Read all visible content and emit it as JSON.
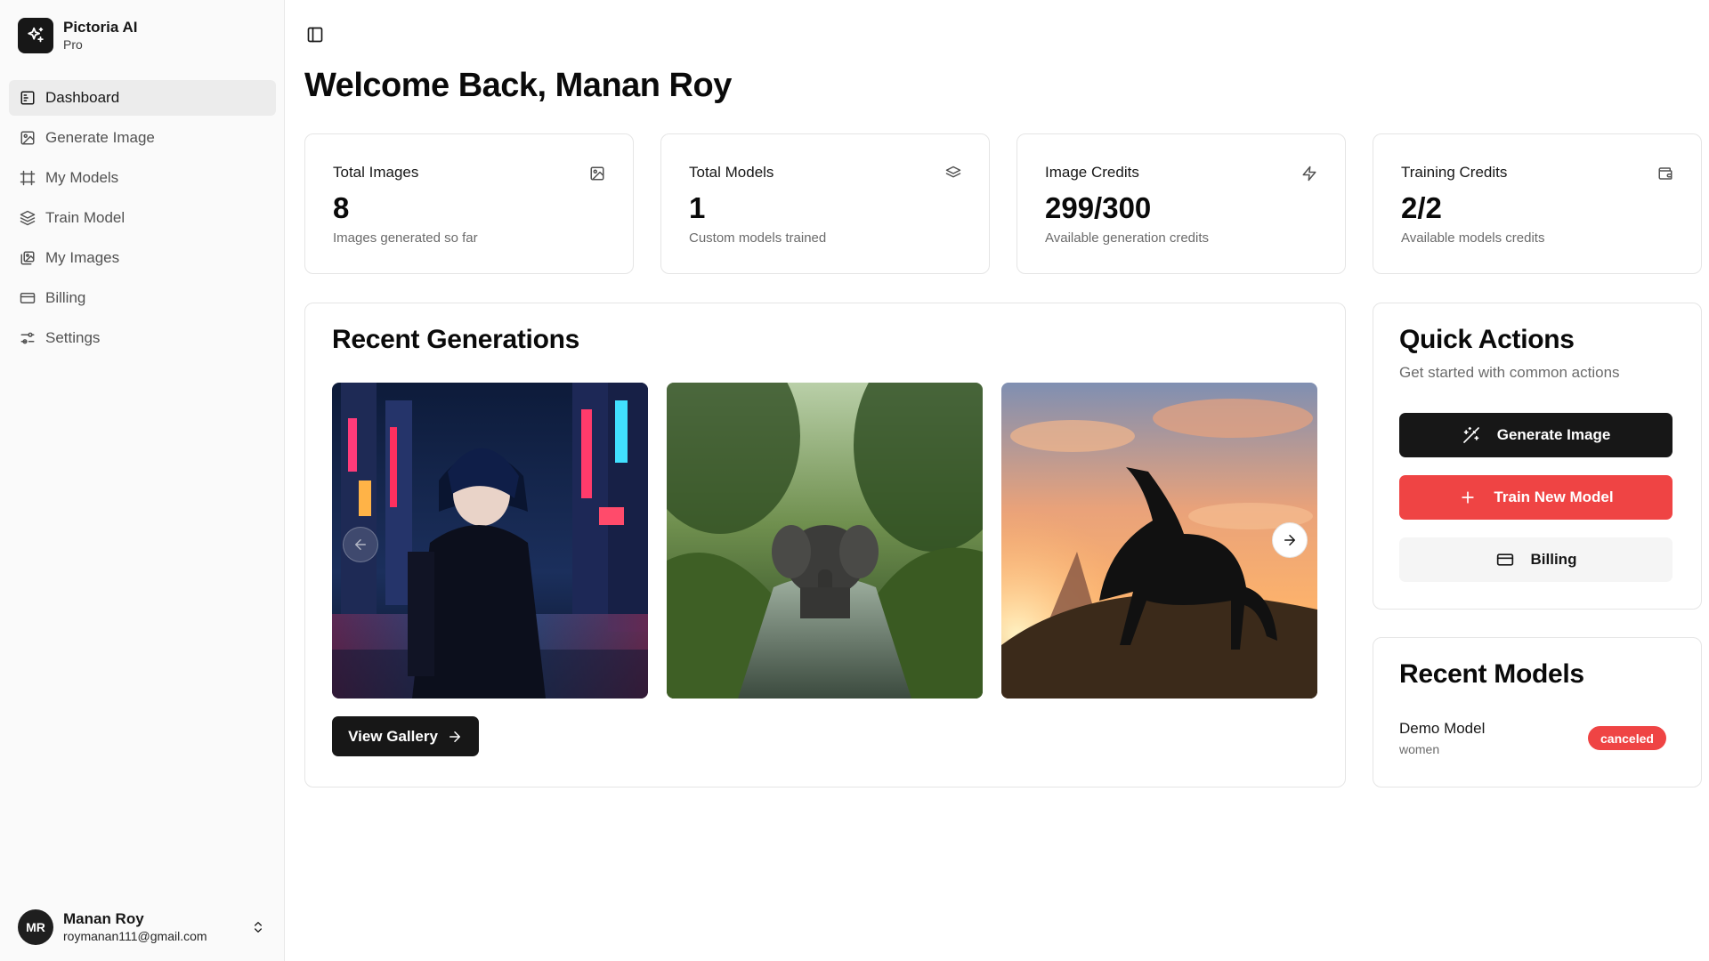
{
  "app": {
    "name": "Pictoria AI",
    "plan": "Pro"
  },
  "sidebar": {
    "items": [
      {
        "label": "Dashboard",
        "icon": "dashboard-icon",
        "active": true
      },
      {
        "label": "Generate Image",
        "icon": "image-icon",
        "active": false
      },
      {
        "label": "My Models",
        "icon": "frame-icon",
        "active": false
      },
      {
        "label": "Train Model",
        "icon": "layers-icon",
        "active": false
      },
      {
        "label": "My Images",
        "icon": "images-icon",
        "active": false
      },
      {
        "label": "Billing",
        "icon": "credit-card-icon",
        "active": false
      },
      {
        "label": "Settings",
        "icon": "settings-sliders-icon",
        "active": false
      }
    ]
  },
  "user": {
    "initials": "MR",
    "name": "Manan Roy",
    "email": "roymanan111@gmail.com"
  },
  "header": {
    "title": "Welcome Back, Manan Roy"
  },
  "stats": [
    {
      "label": "Total Images",
      "value": "8",
      "sub": "Images generated so far",
      "icon": "image-icon"
    },
    {
      "label": "Total Models",
      "value": "1",
      "sub": "Custom models trained",
      "icon": "layers-icon"
    },
    {
      "label": "Image Credits",
      "value": "299/300",
      "sub": "Available generation credits",
      "icon": "zap-icon"
    },
    {
      "label": "Training Credits",
      "value": "2/2",
      "sub": "Available models credits",
      "icon": "wallet-icon"
    }
  ],
  "recent_generations": {
    "title": "Recent Generations",
    "images": [
      {
        "subject": "anime character in neon city street"
      },
      {
        "subject": "elephant walking in forest river"
      },
      {
        "subject": "black horse on hill at sunset"
      }
    ],
    "view_gallery_label": "View Gallery"
  },
  "quick_actions": {
    "title": "Quick Actions",
    "subtitle": "Get started with common actions",
    "buttons": [
      {
        "label": "Generate Image",
        "icon": "wand-sparkles-icon",
        "color": "#171717"
      },
      {
        "label": "Train New Model",
        "icon": "plus-icon",
        "color": "#ef4444"
      },
      {
        "label": "Billing",
        "icon": "credit-card-icon",
        "color": "#f5f5f5"
      }
    ]
  },
  "recent_models": {
    "title": "Recent Models",
    "items": [
      {
        "name": "Demo Model",
        "type": "women",
        "status": "canceled",
        "status_color": "#ef4444"
      }
    ]
  }
}
